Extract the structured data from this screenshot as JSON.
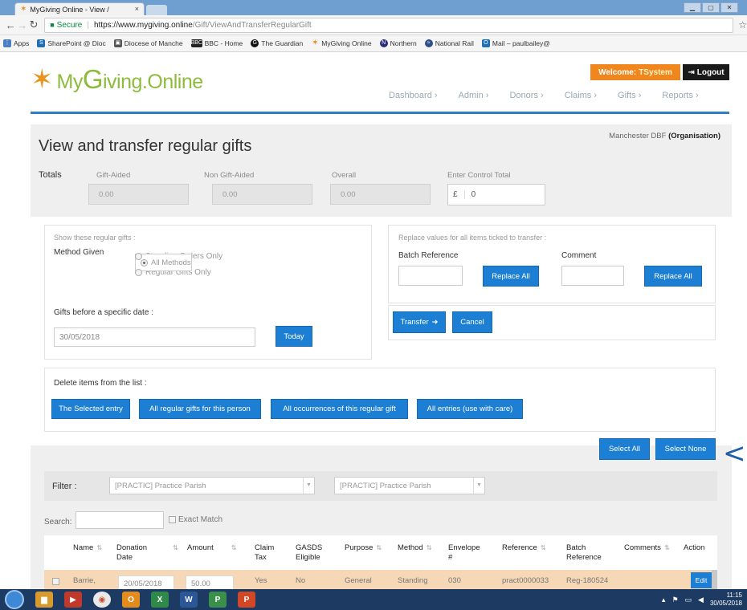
{
  "browser": {
    "tab_title": "MyGiving Online - View / ",
    "tab_close": "×",
    "url_secure": "Secure",
    "url_host": "https://www.mygiving.online",
    "url_path": "/Gift/ViewAndTransferRegularGift",
    "bookmarks": [
      "Apps",
      "SharePoint @ Dioc",
      "Diocese of Manche",
      "BBC - Home",
      "The Guardian",
      "MyGiving Online",
      "Northern",
      "National Rail",
      "Mail – paulbailey@"
    ]
  },
  "header": {
    "logo_my": "My",
    "logo_g": "G",
    "logo_rest": "iving",
    "logo_dot": ".",
    "logo_online": "Online",
    "welcome_label": "Welcome:",
    "welcome_user": "TSystem",
    "logout_label": "Logout",
    "nav": [
      "Dashboard",
      "Admin",
      "Donors",
      "Claims",
      "Gifts",
      "Reports"
    ]
  },
  "page": {
    "organisation_name": "Manchester DBF",
    "organisation_suffix": "(Organisation)",
    "title": "View and transfer regular gifts"
  },
  "totals": {
    "label": "Totals",
    "gift_aided_label": "Gift-Aided",
    "gift_aided_value": "0.00",
    "non_gift_aided_label": "Non Gift-Aided",
    "non_gift_aided_value": "0.00",
    "overall_label": "Overall",
    "overall_value": "0.00",
    "control_label": "Enter Control Total",
    "control_currency": "£",
    "control_value": "0"
  },
  "show_filter": {
    "hint": "Show these regular gifts :",
    "method_label": "Method Given",
    "options": [
      "All Methods",
      "Standing Orders Only",
      "Regular Gifts Only"
    ],
    "selected": "All Methods",
    "date_label": "Gifts before a specific date :",
    "date_value": "30/05/2018",
    "today_button": "Today"
  },
  "replace": {
    "hint": "Replace values for all items ticked to transfer :",
    "batch_label": "Batch Reference",
    "comment_label": "Comment",
    "replace_all_button": "Replace All",
    "replace_all_button_2": "Replace All",
    "transfer_button": "Transfer",
    "cancel_button": "Cancel"
  },
  "delete": {
    "hint": "Delete items from the list :",
    "buttons": [
      "The Selected entry",
      "All regular gifts for this person",
      "All occurrences of this regular gift",
      "All entries (use with care)"
    ]
  },
  "selection": {
    "select_all": "Select All",
    "select_none": "Select None"
  },
  "filter": {
    "label": "Filter :",
    "select_1": "[PRACTIC] Practice Parish",
    "select_2": "[PRACTIC] Practice Parish"
  },
  "search": {
    "label": "Search:",
    "value": "",
    "exact_label": "Exact Match"
  },
  "table": {
    "columns": [
      "Name",
      "Donation Date",
      "Amount",
      "Claim Tax",
      "GASDS Eligible",
      "Purpose",
      "Method",
      "Envelope #",
      "Reference",
      "Batch Reference",
      "Comments",
      "Action"
    ],
    "rows": [
      {
        "name": "Barrie,",
        "donation_date": "20/05/2018",
        "amount": "50.00",
        "claim_tax": "Yes",
        "gasds": "No",
        "purpose": "General",
        "method": "Standing",
        "envelope": "030",
        "reference": "pract0000033",
        "batch_reference": "Reg-180524",
        "comments": "",
        "action": "Edit"
      }
    ]
  },
  "annotation": {
    "glyph": "<"
  },
  "taskbar": {
    "time": "11:15",
    "date": "30/05/2018"
  },
  "colors": {
    "accent": "#1c7fd3",
    "brand_orange": "#f0871e",
    "brand_green": "#8dbb3c",
    "nav_rule": "#2f7fc1",
    "selected_row": "#f6d7b6"
  }
}
